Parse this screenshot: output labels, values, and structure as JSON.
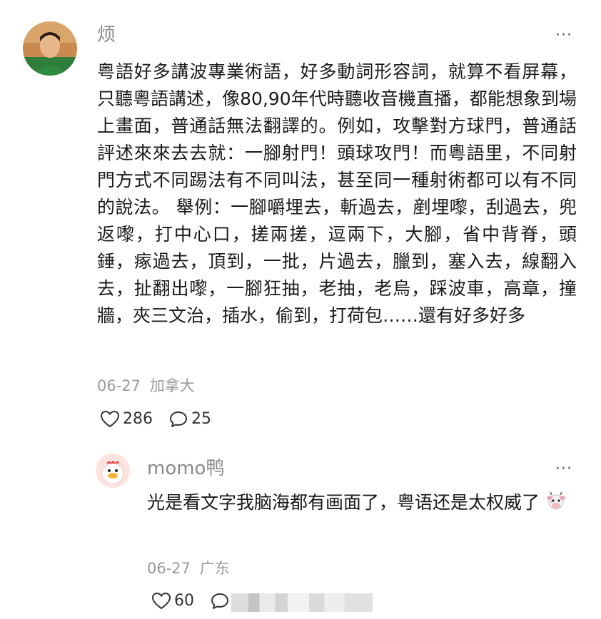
{
  "comment1": {
    "username": "烦",
    "more": "···",
    "text": "粤語好多講波專業術語，好多動詞形容詞，就算不看屏幕，只聽粵語講述，像80,90年代時聽收音機直播，都能想象到場上畫面，普通話無法翻譯的。例如，攻擊對方球門，普通話評述來來去去就：一腳射門！頭球攻門！而粵語里，不同射門方式不同踢法有不同叫法，甚至同一種射術都可以有不同的說法。 舉例：一腳嚼埋去，斬過去，剷埋嚟，刮過去，兜返嚟，打中心口，搓兩搓，逗兩下，大腳，省中背脊，頭錘，瘃過去，頂到，一批，片過去，臘到，塞入去，線翻入去，扯翻出嚟，一腳狂抽，老抽，老烏，踩波車，高章，撞牆，夾三文治，插水，偷到，打荷包……還有好多好多",
    "date": "06-27",
    "location": "加拿大",
    "likes": "286",
    "replies": "25"
  },
  "comment2": {
    "username": "momo鸭",
    "more": "···",
    "text": "光是看文字我脑海都有画面了，粤语还是太权威了",
    "date": "06-27",
    "location": "广东",
    "likes": "60"
  },
  "colors": {
    "text": "#1a1a1a",
    "muted": "#9a9a9a",
    "username": "#8a8a8a"
  },
  "icons": [
    "heart-icon",
    "comment-icon",
    "more-icon",
    "cow-emoji-icon"
  ]
}
